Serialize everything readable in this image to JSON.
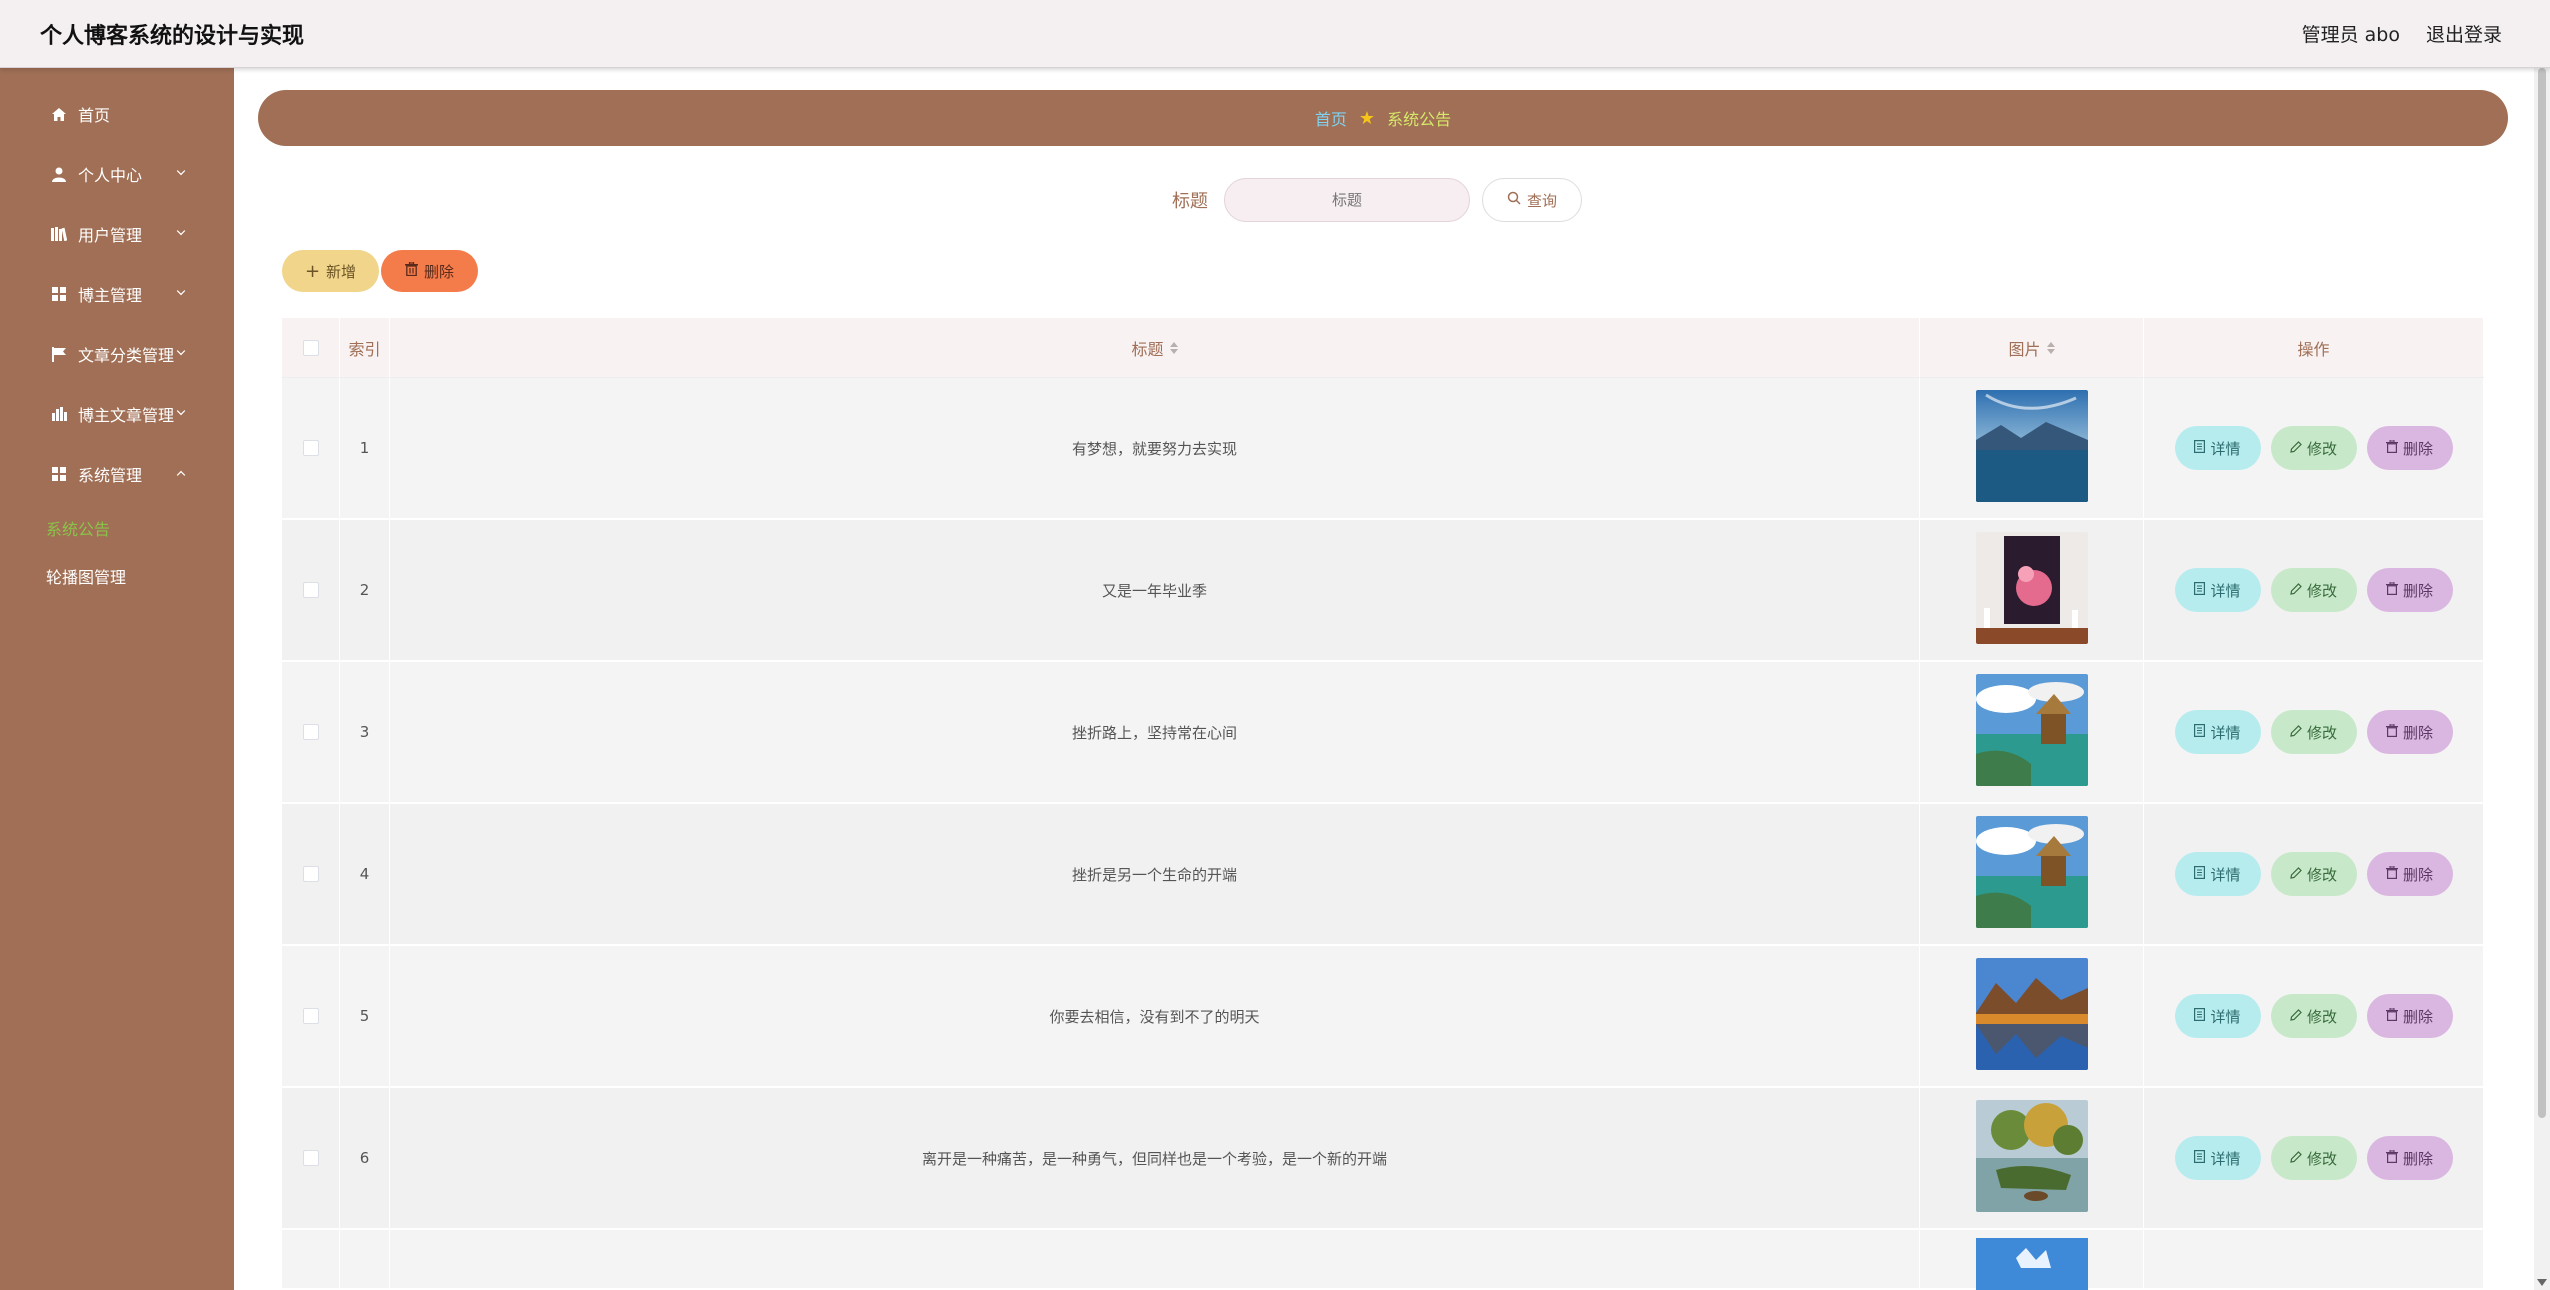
{
  "app": {
    "title": "个人博客系统的设计与实现",
    "user_label": "管理员 abo",
    "logout_label": "退出登录"
  },
  "sidebar": {
    "items": [
      {
        "label": "首页",
        "icon": "home-icon"
      },
      {
        "label": "个人中心",
        "icon": "user-icon"
      },
      {
        "label": "用户管理",
        "icon": "books-icon"
      },
      {
        "label": "博主管理",
        "icon": "grid-icon"
      },
      {
        "label": "文章分类管理",
        "icon": "flag-icon"
      },
      {
        "label": "博主文章管理",
        "icon": "bar-chart-icon"
      },
      {
        "label": "系统管理",
        "icon": "grid-icon"
      }
    ],
    "sub_items": [
      {
        "label": "系统公告",
        "active": true
      },
      {
        "label": "轮播图管理",
        "active": false
      }
    ]
  },
  "breadcrumb": {
    "home": "首页",
    "current": "系统公告"
  },
  "search": {
    "label": "标题",
    "placeholder": "标题",
    "button_label": "查询"
  },
  "toolbar": {
    "add_label": "新增",
    "delete_label": "删除"
  },
  "table": {
    "columns": {
      "index": "索引",
      "title": "标题",
      "image": "图片",
      "ops": "操作"
    },
    "rows": [
      {
        "index": "1",
        "title": "有梦想，就要努力去实现",
        "image": "lake-mountains"
      },
      {
        "index": "2",
        "title": "又是一年毕业季",
        "image": "flower-painting"
      },
      {
        "index": "3",
        "title": "挫折路上，坚持常在心间",
        "image": "tropical-hut"
      },
      {
        "index": "4",
        "title": "挫折是另一个生命的开端",
        "image": "tropical-hut"
      },
      {
        "index": "5",
        "title": "你要去相信，没有到不了的明天",
        "image": "autumn-lake"
      },
      {
        "index": "6",
        "title": "离开是一种痛苦，是一种勇气，但同样也是一个考验，是一个新的开端",
        "image": "riverbank-trees"
      }
    ],
    "op_labels": {
      "detail": "详情",
      "edit": "修改",
      "delete": "删除"
    }
  },
  "colors": {
    "brand": "#a06f55",
    "active_sub": "#8bc34a",
    "add_button": "#f0d58a",
    "delete_button": "#f47c4a"
  }
}
